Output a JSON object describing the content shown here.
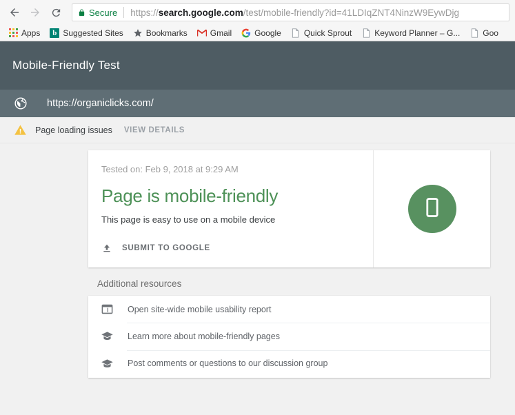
{
  "browser": {
    "back_icon": "back-arrow-icon",
    "forward_icon": "forward-arrow-icon",
    "reload_icon": "reload-icon",
    "security_label": "Secure",
    "lock_icon": "lock-icon",
    "url": {
      "full": "https://search.google.com/test/mobile-friendly?id=41LDIqZNT4NinzW9EywDjg",
      "scheme": "https://",
      "host": "search.google.com",
      "path": "/test/mobile-friendly?id=41LDIqZNT4NinzW9EywDjg"
    },
    "secure_color": "#0b8043",
    "bookmarks": [
      {
        "label": "Apps",
        "icon": "apps-grid-icon"
      },
      {
        "label": "Suggested Sites",
        "icon": "bing-icon"
      },
      {
        "label": "Bookmarks",
        "icon": "star-icon"
      },
      {
        "label": "Gmail",
        "icon": "gmail-icon"
      },
      {
        "label": "Google",
        "icon": "google-g-icon"
      },
      {
        "label": "Quick Sprout",
        "icon": "page-icon"
      },
      {
        "label": "Keyword Planner – G...",
        "icon": "page-icon"
      },
      {
        "label": "Goo",
        "icon": "page-icon"
      }
    ]
  },
  "app": {
    "title": "Mobile-Friendly Test",
    "header_color": "#4e5c63",
    "url_bar_color": "#5f6e75",
    "tested_url": "https://organiclicks.com/",
    "globe_icon": "globe-icon"
  },
  "warning": {
    "icon": "warning-triangle-icon",
    "icon_color": "#f4c242",
    "text": "Page loading issues",
    "action_label": "VIEW DETAILS"
  },
  "result": {
    "tested_on": "Tested on: Feb 9, 2018 at 9:29 AM",
    "verdict": "Page is mobile-friendly",
    "verdict_color": "#4d9157",
    "description": "This page is easy to use on a mobile device",
    "submit_label": "SUBMIT TO GOOGLE",
    "submit_icon": "upload-icon",
    "badge_icon": "mobile-phone-icon",
    "badge_color": "#589160"
  },
  "resources": {
    "title": "Additional resources",
    "items": [
      {
        "label": "Open site-wide mobile usability report",
        "icon": "dashboard-report-icon"
      },
      {
        "label": "Learn more about mobile-friendly pages",
        "icon": "graduation-cap-icon"
      },
      {
        "label": "Post comments or questions to our discussion group",
        "icon": "graduation-cap-icon"
      }
    ]
  }
}
